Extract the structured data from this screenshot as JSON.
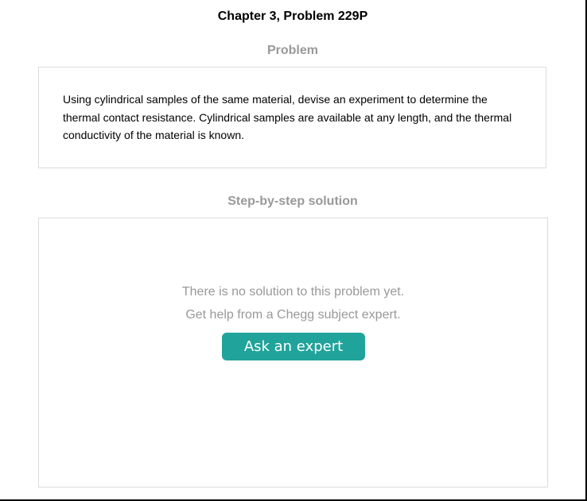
{
  "chapter_title": "Chapter 3, Problem 229P",
  "problem": {
    "heading": "Problem",
    "text": "Using cylindrical samples of the same material, devise an experiment to determine the thermal contact resistance. Cylindrical samples are available at any length, and the thermal conductivity of the material is known."
  },
  "solution": {
    "heading": "Step-by-step solution",
    "no_solution_line1": "There is no solution to this problem yet.",
    "no_solution_line2": "Get help from a Chegg subject expert.",
    "ask_button_label": "Ask an expert",
    "ask_button_color": "#20a39a"
  }
}
